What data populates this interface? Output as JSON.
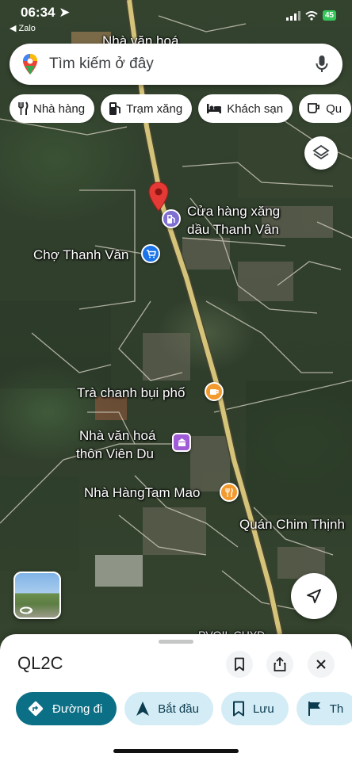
{
  "status_bar": {
    "time": "06:34",
    "back_app": "◀ Zalo",
    "battery": "45"
  },
  "search": {
    "placeholder": "Tìm kiếm ở đây"
  },
  "chips": [
    {
      "label": "Nhà hàng",
      "icon": "restaurant-icon"
    },
    {
      "label": "Trạm xăng",
      "icon": "gas-station-icon"
    },
    {
      "label": "Khách sạn",
      "icon": "hotel-icon"
    },
    {
      "label": "Qu",
      "icon": "coffee-icon"
    }
  ],
  "map_labels": {
    "top_cut": "Nhà văn hoá",
    "gas_line1": "Cửa hàng xăng",
    "gas_line2": "dầu Thanh Vân",
    "market": "Chợ Thanh Vân",
    "tea": "Trà chanh bụi phố",
    "culture_line1": "Nhà văn hoá",
    "culture_line2": "thôn Viên Du",
    "restaurant": "Nhà HàngTam Mao",
    "quan": "Quán Chim Thịnh",
    "bottom_cut": "PVOIL CHYD"
  },
  "colors": {
    "road": "#c9b86a",
    "pin_red": "#e53935",
    "gas_pin": "#7e6fd1",
    "shop_pin": "#1a73e8",
    "cafe_pin": "#f29a2e",
    "culture_pin": "#a05cd6",
    "restaurant_pin": "#f29a2e",
    "directions_button": "#0b6f86",
    "action_button": "#d3ecf5"
  },
  "sheet": {
    "title": "QL2C",
    "actions": [
      {
        "label": "Đường đi",
        "icon": "directions-icon"
      },
      {
        "label": "Bắt đầu",
        "icon": "navigation-arrow-icon"
      },
      {
        "label": "Lưu",
        "icon": "bookmark-icon"
      },
      {
        "label": "Th",
        "icon": "flag-icon"
      }
    ]
  }
}
